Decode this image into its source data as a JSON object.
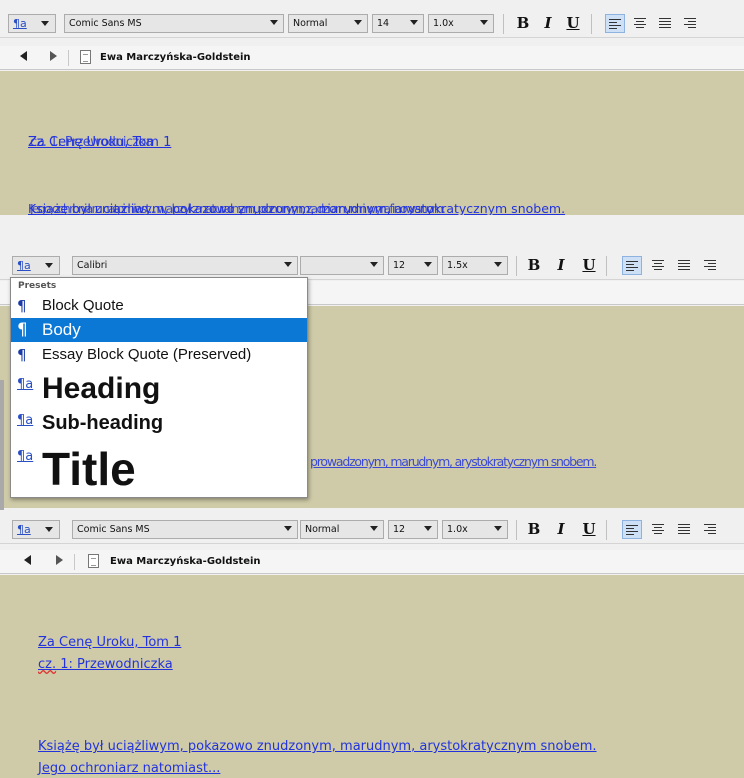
{
  "panel1": {
    "style_combo_value": "",
    "font_value": "Comic Sans MS",
    "weight_value": "Normal",
    "size_value": "14",
    "spacing_value": "1.0x",
    "bold_label": "B",
    "italic_label": "I",
    "underline_label": "U",
    "author": "Ewa Marczyńska-Goldstein",
    "title_line": "Za Cenę Uroku, Tom 1",
    "title_ghost": "cz. 1: Przewodniczka",
    "para_line": "Książę był uciążliwym, pokazowo znudzonym, marudnym, arystokratycznym snobem.",
    "para_ghost": "Jego ochroniarz natomiast... walczył z naturalnym, ponurym, zadziornym i wyrafinowanym."
  },
  "panel2": {
    "font_value": "Calibri",
    "weight_value": "",
    "size_value": "12",
    "spacing_value": "1.5x",
    "bold_label": "B",
    "italic_label": "I",
    "underline_label": "U",
    "bg_text": "prowadzonym, marudnym, arystokratycznym snobem."
  },
  "style_dropdown": {
    "header": "Presets",
    "items": [
      {
        "label": "Block Quote",
        "marker": "¶"
      },
      {
        "label": "Body",
        "marker": "¶"
      },
      {
        "label": "Essay Block Quote (Preserved)",
        "marker": "¶"
      },
      {
        "label": "Heading",
        "marker": "¶a"
      },
      {
        "label": "Sub-heading",
        "marker": "¶a"
      },
      {
        "label": "Title",
        "marker": "¶a"
      }
    ],
    "selected": "Body"
  },
  "panel3": {
    "font_value": "Comic Sans MS",
    "weight_value": "Normal",
    "size_value": "12",
    "spacing_value": "1.0x",
    "bold_label": "B",
    "italic_label": "I",
    "underline_label": "U",
    "author": "Ewa Marczyńska-Goldstein",
    "title_line1": "Za Cenę Uroku, Tom 1",
    "title_line2_a": "cz.",
    "title_line2_b": " 1: Przewodniczka",
    "para_line1": "Książę był uciążliwym, pokazowo znudzonym, marudnym, arystokratycznym snobem.",
    "para_line2": "Jego ochroniarz natomiast..."
  },
  "style_marker": "¶a",
  "colors": {
    "editor_bg": "#cfcba8",
    "link": "#2233dd",
    "selection": "#0a78d4"
  }
}
